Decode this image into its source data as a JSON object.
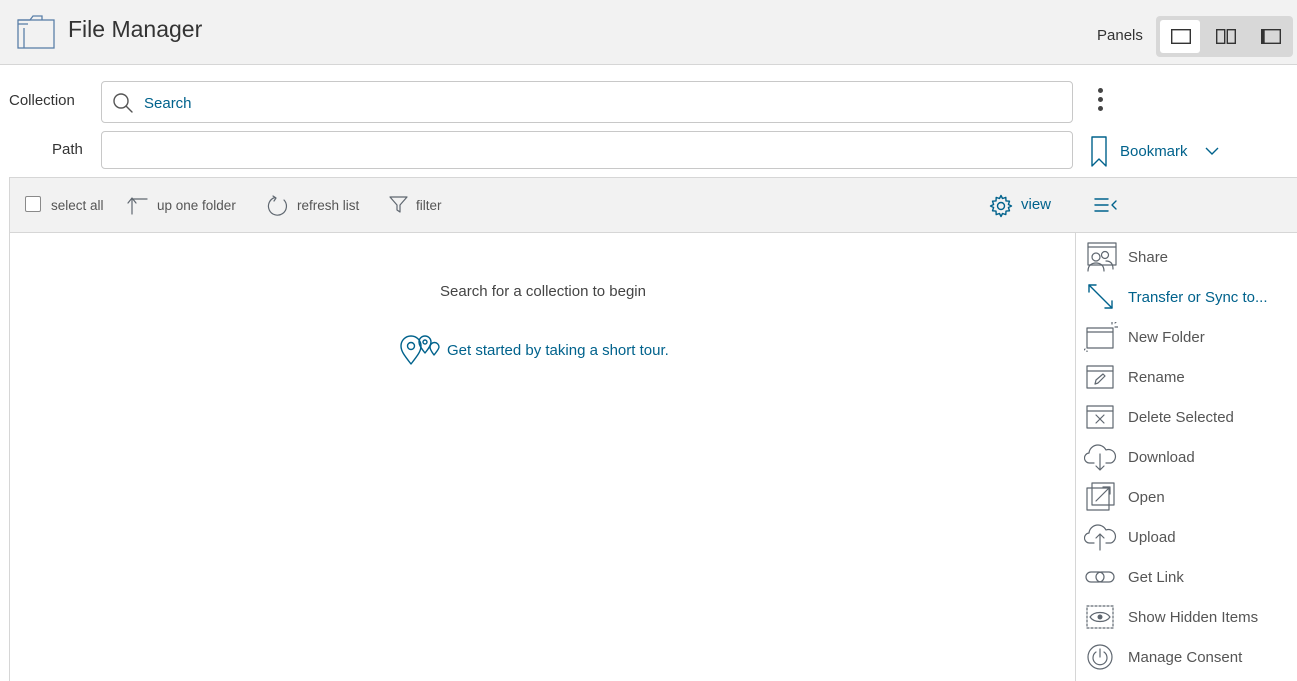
{
  "app": {
    "title": "File Manager",
    "icon": "folder-icon"
  },
  "panels": {
    "label": "Panels",
    "options": [
      {
        "icon": "single-panel-icon",
        "active": true
      },
      {
        "icon": "double-panel-icon",
        "active": false
      },
      {
        "icon": "right-panel-icon",
        "active": false
      }
    ]
  },
  "collection": {
    "label": "Collection",
    "placeholder": "Search",
    "value": ""
  },
  "path": {
    "label": "Path",
    "value": ""
  },
  "bookmark": {
    "label": "Bookmark"
  },
  "toolbar": {
    "select_all": "select all",
    "up_one_folder": "up one folder",
    "refresh_list": "refresh list",
    "filter": "filter",
    "view": "view"
  },
  "main": {
    "empty_message": "Search for a collection to begin",
    "tour_link": "Get started by taking a short tour."
  },
  "actions": [
    {
      "label": "Share",
      "icon": "share-icon"
    },
    {
      "label": "Transfer or Sync to...",
      "icon": "transfer-icon"
    },
    {
      "label": "New Folder",
      "icon": "new-folder-icon"
    },
    {
      "label": "Rename",
      "icon": "rename-icon"
    },
    {
      "label": "Delete Selected",
      "icon": "delete-icon"
    },
    {
      "label": "Download",
      "icon": "download-icon"
    },
    {
      "label": "Open",
      "icon": "open-icon"
    },
    {
      "label": "Upload",
      "icon": "upload-icon"
    },
    {
      "label": "Get Link",
      "icon": "link-icon"
    },
    {
      "label": "Show Hidden Items",
      "icon": "eye-icon"
    },
    {
      "label": "Manage Consent",
      "icon": "power-icon"
    }
  ],
  "colors": {
    "accent": "#00628c",
    "header_bg": "#f2f2f2",
    "border": "#d6d6d6"
  }
}
